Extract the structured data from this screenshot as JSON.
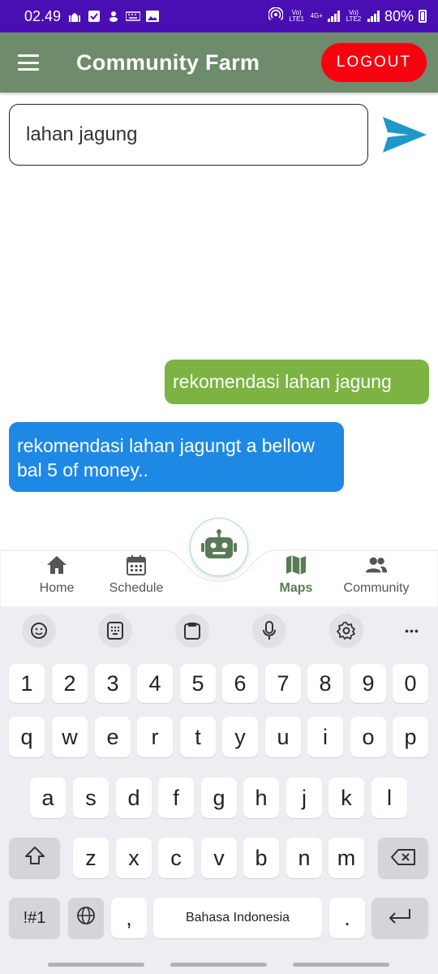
{
  "status_bar": {
    "time": "02.49",
    "icons": [
      "mosque-icon",
      "checkbox-icon",
      "baby-icon",
      "keyboard-icon",
      "image-icon"
    ],
    "lte1_label": "Vo) LTE1",
    "net_label": "4G+",
    "lte2_label": "Vo) LTE2",
    "battery": "80%"
  },
  "app_bar": {
    "title": "Community Farm",
    "logout_label": "LOGOUT"
  },
  "chat_input": {
    "value": "lahan jagung"
  },
  "messages": [
    {
      "sender": "user",
      "text": "rekomendasi lahan jagung"
    },
    {
      "sender": "bot",
      "text": "rekomendasi lahan jagungt a bellow bal 5 of money.."
    }
  ],
  "bottom_nav": {
    "items": [
      {
        "label": "Home",
        "icon": "home-icon"
      },
      {
        "label": "Schedule",
        "icon": "calendar-icon"
      },
      {
        "label": "Maps",
        "icon": "map-icon",
        "active": true
      },
      {
        "label": "Community",
        "icon": "people-icon"
      }
    ],
    "fab_icon": "robot-icon"
  },
  "keyboard": {
    "toolbar": [
      "emoji-icon",
      "clipboard-grid-icon",
      "clipboard-icon",
      "mic-icon",
      "gear-icon",
      "more-icon"
    ],
    "more_label": "•••",
    "row_numbers": [
      "1",
      "2",
      "3",
      "4",
      "5",
      "6",
      "7",
      "8",
      "9",
      "0"
    ],
    "row1": [
      "q",
      "w",
      "e",
      "r",
      "t",
      "y",
      "u",
      "i",
      "o",
      "p"
    ],
    "row2": [
      "a",
      "s",
      "d",
      "f",
      "g",
      "h",
      "j",
      "k",
      "l"
    ],
    "row3": [
      "z",
      "x",
      "c",
      "v",
      "b",
      "n",
      "m"
    ],
    "symbols_label": "!#1",
    "comma_label": ",",
    "space_label": "Bahasa Indonesia",
    "period_label": "."
  },
  "colors": {
    "status_bar": "#4a0fb3",
    "app_bar": "#6e8b6b",
    "logout": "#f50410",
    "send": "#1e98c9",
    "user_bubble": "#7cb342",
    "bot_bubble": "#1e88e5",
    "nav_active": "#5a7a57"
  }
}
